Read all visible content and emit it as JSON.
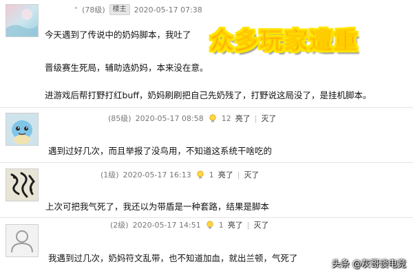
{
  "overlay": {
    "title": "众多玩家遭重"
  },
  "watermark": "头条 @灰哥谈电竞",
  "comments": [
    {
      "username": "\"",
      "level": "(78级)",
      "badge": "楼主",
      "timestamp": "2020-05-17 07:38",
      "lines": [
        "今天遇到了传说中的奶妈脚本，我吐了",
        "晋级赛生死局，辅助选奶妈，本来没在意。",
        "进游戏后帮打野打红buff，奶妈刷刷把自己先奶残了，打野说这局没了，是挂机脚本。"
      ]
    },
    {
      "level": "(85级)",
      "timestamp": "2020-05-17 08:58",
      "likes": "12",
      "like_label": "亮了",
      "kill_label": "灭了",
      "lines": [
        "遇到过好几次，而且举报了没鸟用，不知道这系统干啥吃的"
      ]
    },
    {
      "level": "(1级)",
      "timestamp": "2020-05-17 16:13",
      "likes": "1",
      "like_label": "亮了",
      "kill_label": "灭了",
      "lines": [
        "上次可把我气死了，我还以为带盾是一种套路，结果是脚本"
      ]
    },
    {
      "level": "(2级)",
      "timestamp": "2020-05-17 14:51",
      "likes": "1",
      "like_label": "亮了",
      "kill_label": "灭了",
      "lines": [
        "我遇到过几次，奶妈符文乱带，也不知道加血，就出兰顿，气死了"
      ]
    }
  ]
}
